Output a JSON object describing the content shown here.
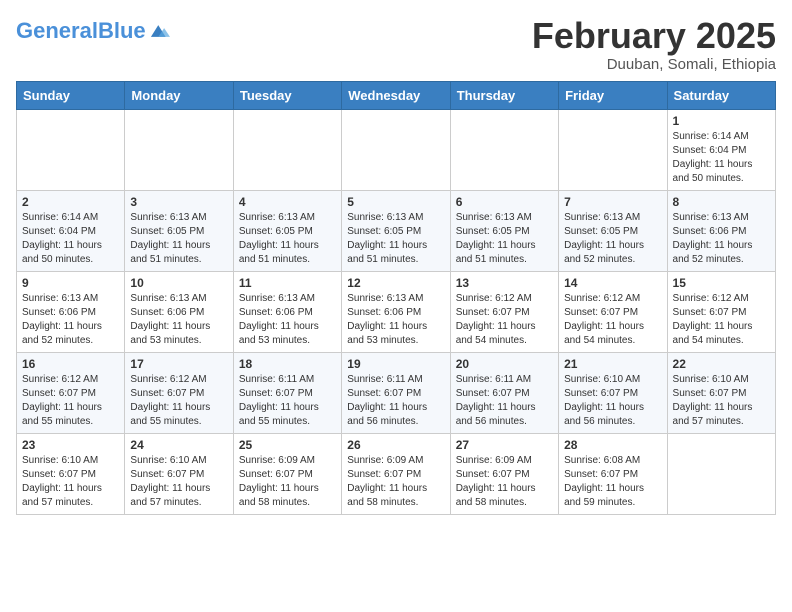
{
  "header": {
    "logo_general": "General",
    "logo_blue": "Blue",
    "month_title": "February 2025",
    "location": "Duuban, Somali, Ethiopia"
  },
  "weekdays": [
    "Sunday",
    "Monday",
    "Tuesday",
    "Wednesday",
    "Thursday",
    "Friday",
    "Saturday"
  ],
  "weeks": [
    [
      {
        "day": "",
        "info": ""
      },
      {
        "day": "",
        "info": ""
      },
      {
        "day": "",
        "info": ""
      },
      {
        "day": "",
        "info": ""
      },
      {
        "day": "",
        "info": ""
      },
      {
        "day": "",
        "info": ""
      },
      {
        "day": "1",
        "info": "Sunrise: 6:14 AM\nSunset: 6:04 PM\nDaylight: 11 hours\nand 50 minutes."
      }
    ],
    [
      {
        "day": "2",
        "info": "Sunrise: 6:14 AM\nSunset: 6:04 PM\nDaylight: 11 hours\nand 50 minutes."
      },
      {
        "day": "3",
        "info": "Sunrise: 6:13 AM\nSunset: 6:05 PM\nDaylight: 11 hours\nand 51 minutes."
      },
      {
        "day": "4",
        "info": "Sunrise: 6:13 AM\nSunset: 6:05 PM\nDaylight: 11 hours\nand 51 minutes."
      },
      {
        "day": "5",
        "info": "Sunrise: 6:13 AM\nSunset: 6:05 PM\nDaylight: 11 hours\nand 51 minutes."
      },
      {
        "day": "6",
        "info": "Sunrise: 6:13 AM\nSunset: 6:05 PM\nDaylight: 11 hours\nand 51 minutes."
      },
      {
        "day": "7",
        "info": "Sunrise: 6:13 AM\nSunset: 6:05 PM\nDaylight: 11 hours\nand 52 minutes."
      },
      {
        "day": "8",
        "info": "Sunrise: 6:13 AM\nSunset: 6:06 PM\nDaylight: 11 hours\nand 52 minutes."
      }
    ],
    [
      {
        "day": "9",
        "info": "Sunrise: 6:13 AM\nSunset: 6:06 PM\nDaylight: 11 hours\nand 52 minutes."
      },
      {
        "day": "10",
        "info": "Sunrise: 6:13 AM\nSunset: 6:06 PM\nDaylight: 11 hours\nand 53 minutes."
      },
      {
        "day": "11",
        "info": "Sunrise: 6:13 AM\nSunset: 6:06 PM\nDaylight: 11 hours\nand 53 minutes."
      },
      {
        "day": "12",
        "info": "Sunrise: 6:13 AM\nSunset: 6:06 PM\nDaylight: 11 hours\nand 53 minutes."
      },
      {
        "day": "13",
        "info": "Sunrise: 6:12 AM\nSunset: 6:07 PM\nDaylight: 11 hours\nand 54 minutes."
      },
      {
        "day": "14",
        "info": "Sunrise: 6:12 AM\nSunset: 6:07 PM\nDaylight: 11 hours\nand 54 minutes."
      },
      {
        "day": "15",
        "info": "Sunrise: 6:12 AM\nSunset: 6:07 PM\nDaylight: 11 hours\nand 54 minutes."
      }
    ],
    [
      {
        "day": "16",
        "info": "Sunrise: 6:12 AM\nSunset: 6:07 PM\nDaylight: 11 hours\nand 55 minutes."
      },
      {
        "day": "17",
        "info": "Sunrise: 6:12 AM\nSunset: 6:07 PM\nDaylight: 11 hours\nand 55 minutes."
      },
      {
        "day": "18",
        "info": "Sunrise: 6:11 AM\nSunset: 6:07 PM\nDaylight: 11 hours\nand 55 minutes."
      },
      {
        "day": "19",
        "info": "Sunrise: 6:11 AM\nSunset: 6:07 PM\nDaylight: 11 hours\nand 56 minutes."
      },
      {
        "day": "20",
        "info": "Sunrise: 6:11 AM\nSunset: 6:07 PM\nDaylight: 11 hours\nand 56 minutes."
      },
      {
        "day": "21",
        "info": "Sunrise: 6:10 AM\nSunset: 6:07 PM\nDaylight: 11 hours\nand 56 minutes."
      },
      {
        "day": "22",
        "info": "Sunrise: 6:10 AM\nSunset: 6:07 PM\nDaylight: 11 hours\nand 57 minutes."
      }
    ],
    [
      {
        "day": "23",
        "info": "Sunrise: 6:10 AM\nSunset: 6:07 PM\nDaylight: 11 hours\nand 57 minutes."
      },
      {
        "day": "24",
        "info": "Sunrise: 6:10 AM\nSunset: 6:07 PM\nDaylight: 11 hours\nand 57 minutes."
      },
      {
        "day": "25",
        "info": "Sunrise: 6:09 AM\nSunset: 6:07 PM\nDaylight: 11 hours\nand 58 minutes."
      },
      {
        "day": "26",
        "info": "Sunrise: 6:09 AM\nSunset: 6:07 PM\nDaylight: 11 hours\nand 58 minutes."
      },
      {
        "day": "27",
        "info": "Sunrise: 6:09 AM\nSunset: 6:07 PM\nDaylight: 11 hours\nand 58 minutes."
      },
      {
        "day": "28",
        "info": "Sunrise: 6:08 AM\nSunset: 6:07 PM\nDaylight: 11 hours\nand 59 minutes."
      },
      {
        "day": "",
        "info": ""
      }
    ]
  ]
}
